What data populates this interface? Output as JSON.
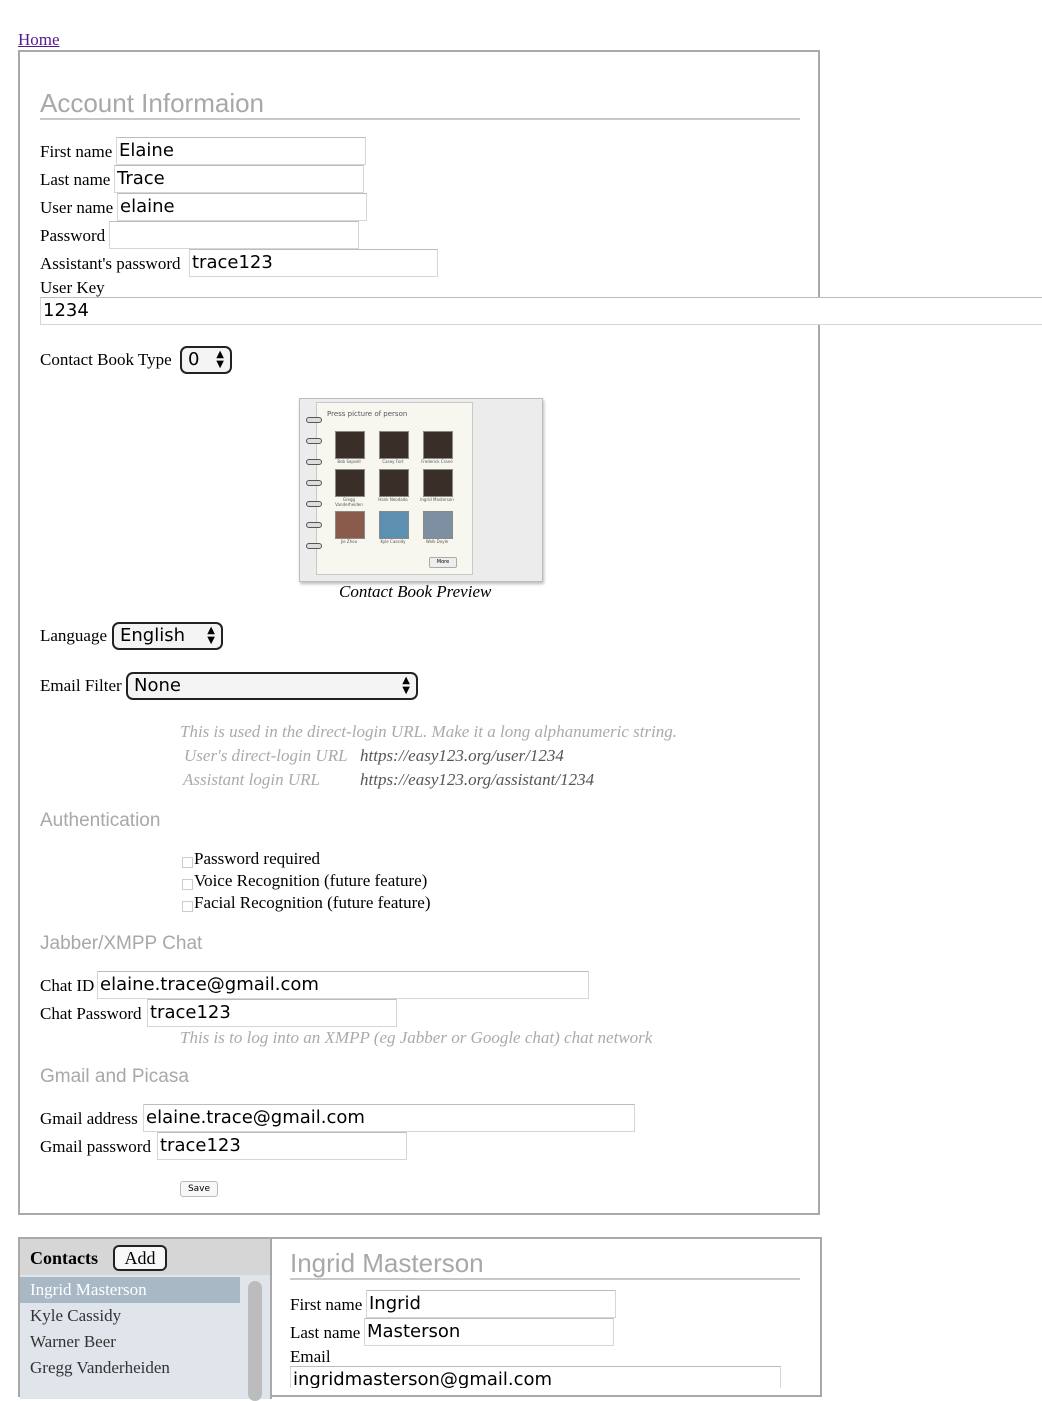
{
  "nav": {
    "home_link": "Home"
  },
  "account": {
    "title": "Account Informaion",
    "first_name_label": "First name",
    "first_name_value": "Elaine",
    "last_name_label": "Last name",
    "last_name_value": "Trace",
    "user_name_label": "User name",
    "user_name_value": "elaine",
    "password_label": "Password",
    "password_value": "",
    "assistant_password_label": "Assistant's password",
    "assistant_password_value": "trace123",
    "user_key_label": "User Key",
    "user_key_value": "1234",
    "contact_book_type_label": "Contact Book Type",
    "contact_book_type_value": "0",
    "preview_caption": "Contact Book Preview",
    "preview_book": {
      "header": "Press picture of person",
      "people": [
        "Bob Sepsell",
        "Casey Fort",
        "Frederick Crane",
        "Gregg Vanderheiden",
        "Hank Neodado",
        "Ingrid Masterson",
        "Jie Zhou",
        "Kyle Cassidy",
        "Walk Doyle"
      ],
      "more_button": "More"
    },
    "language_label": "Language",
    "language_value": "English",
    "email_filter_label": "Email Filter",
    "email_filter_value": "None",
    "user_key_hint": "This is used in the direct-login URL. Make it a long alphanumeric string.",
    "direct_login_label": "User's direct-login URL",
    "direct_login_url": "https://easy123.org/user/1234",
    "assistant_login_label": "Assistant login URL",
    "assistant_login_url": "https://easy123.org/assistant/1234"
  },
  "authentication": {
    "title": "Authentication",
    "options": [
      {
        "label": "Password required",
        "checked": false
      },
      {
        "label": "Voice Recognition (future feature)",
        "checked": false
      },
      {
        "label": "Facial Recognition (future feature)",
        "checked": false
      }
    ]
  },
  "chat": {
    "title": "Jabber/XMPP Chat",
    "chat_id_label": "Chat ID",
    "chat_id_value": "elaine.trace@gmail.com",
    "chat_password_label": "Chat Password",
    "chat_password_value": "trace123",
    "hint": "This is to log into an XMPP (eg Jabber or Google chat) chat network"
  },
  "gmail": {
    "title": "Gmail and Picasa",
    "address_label": "Gmail address",
    "address_value": "elaine.trace@gmail.com",
    "password_label": "Gmail password",
    "password_value": "trace123",
    "save_label": "Save"
  },
  "contacts": {
    "title": "Contacts",
    "add_label": "Add",
    "items": [
      "Ingrid Masterson",
      "Kyle Cassidy",
      "Warner Beer",
      "Gregg Vanderheiden"
    ],
    "selected_index": 0
  },
  "contact_detail": {
    "title": "Ingrid Masterson",
    "first_name_label": "First name",
    "first_name_value": "Ingrid",
    "last_name_label": "Last name",
    "last_name_value": "Masterson",
    "email_label": "Email",
    "email_value": "ingridmasterson@gmail.com"
  }
}
